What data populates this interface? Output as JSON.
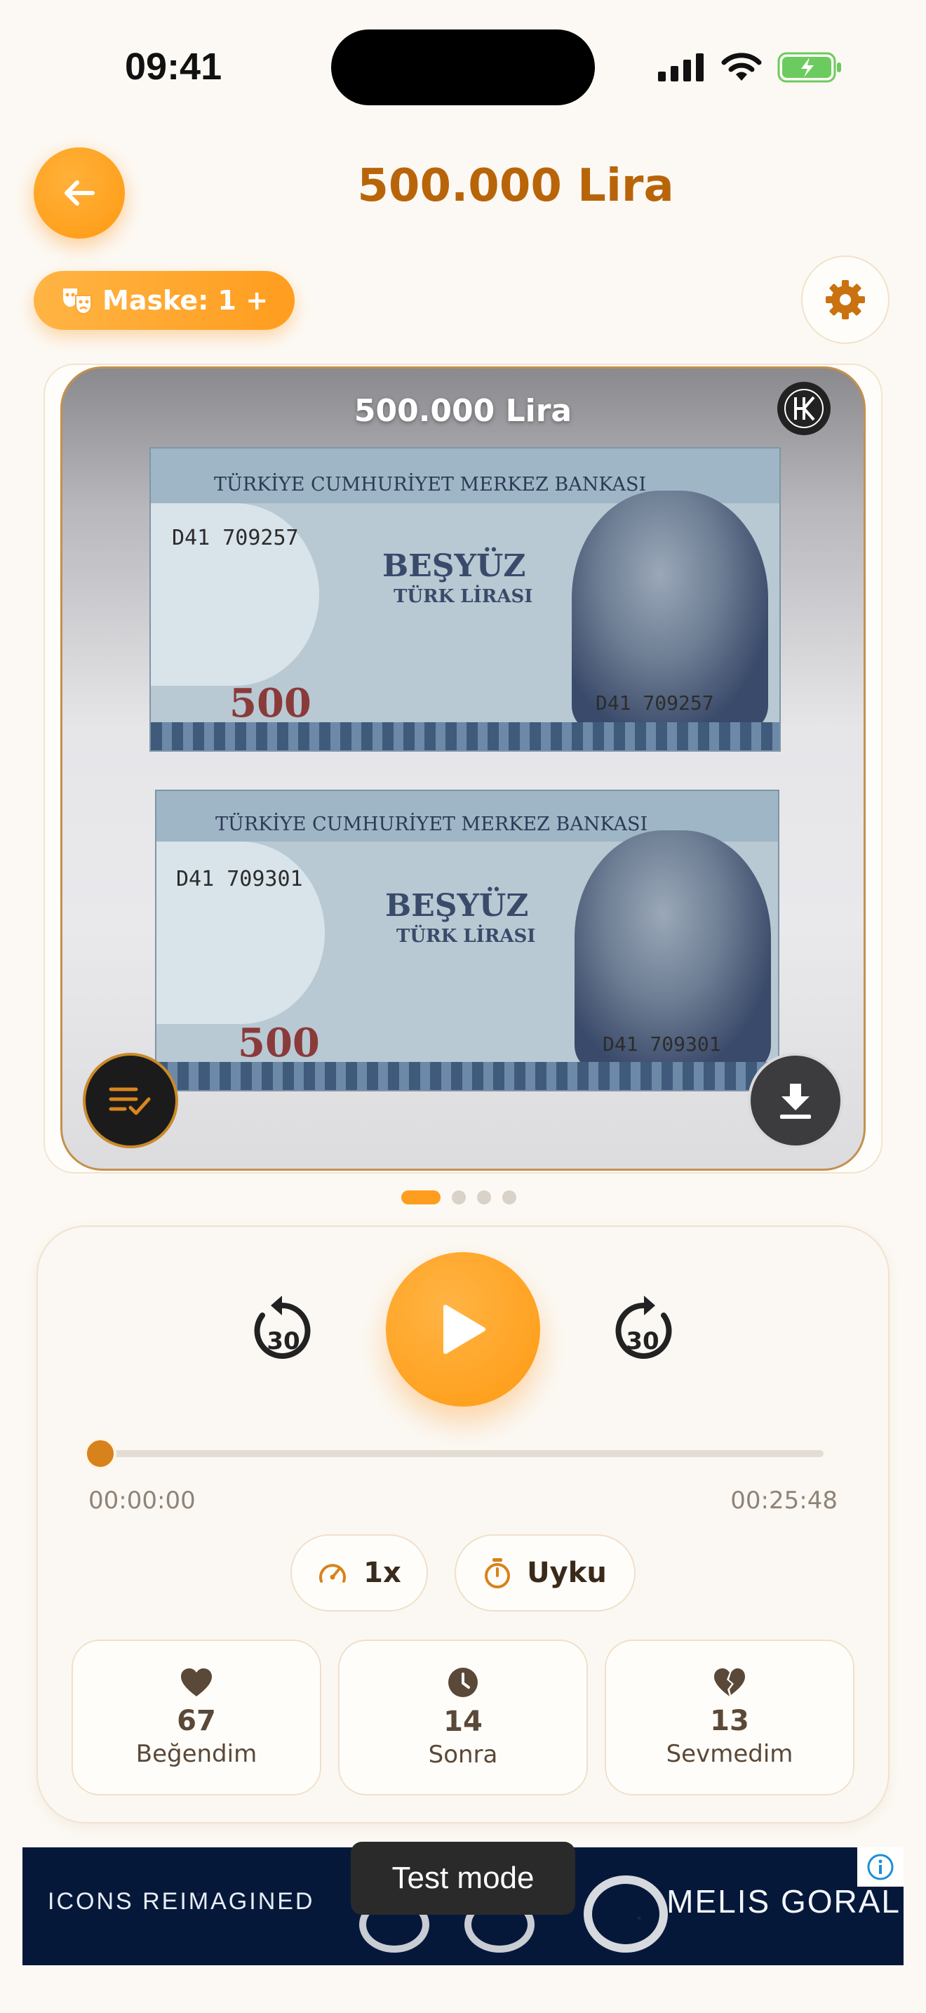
{
  "status_bar": {
    "time": "09:41"
  },
  "header": {
    "title": "500.000 Lira"
  },
  "mask": {
    "label": "Maske: 1 +"
  },
  "card": {
    "title": "500.000 Lira",
    "notes": [
      {
        "bank": "TÜRKİYE CUMHURİYET MERKEZ BANKASI",
        "name": "BEŞYÜZ",
        "sub": "TÜRK LİRASI",
        "serial": "D41 709257",
        "value": "500"
      },
      {
        "bank": "TÜRKİYE CUMHURİYET MERKEZ BANKASI",
        "name": "BEŞYÜZ",
        "sub": "TÜRK LİRASI",
        "serial": "D41 709301",
        "value": "500"
      }
    ],
    "pages": 4,
    "active_page": 0
  },
  "player": {
    "time_current": "00:00:00",
    "time_total": "00:25:48",
    "skip_back": "30",
    "skip_forward": "30",
    "progress": 0,
    "speed": "1x",
    "sleep": "Uyku"
  },
  "stats": [
    {
      "icon": "heart-icon",
      "count": "67",
      "label": "Beğendim"
    },
    {
      "icon": "clock-icon",
      "count": "14",
      "label": "Sonra"
    },
    {
      "icon": "broken-heart-icon",
      "count": "13",
      "label": "Sevmedim"
    }
  ],
  "ad": {
    "left_text": "ICONS REIMAGINED",
    "right_text": "MELIS GORAL",
    "toast": "Test mode"
  },
  "colors": {
    "accent": "#ff9d1e",
    "title": "#b8650a",
    "background": "#fcf9f4"
  }
}
